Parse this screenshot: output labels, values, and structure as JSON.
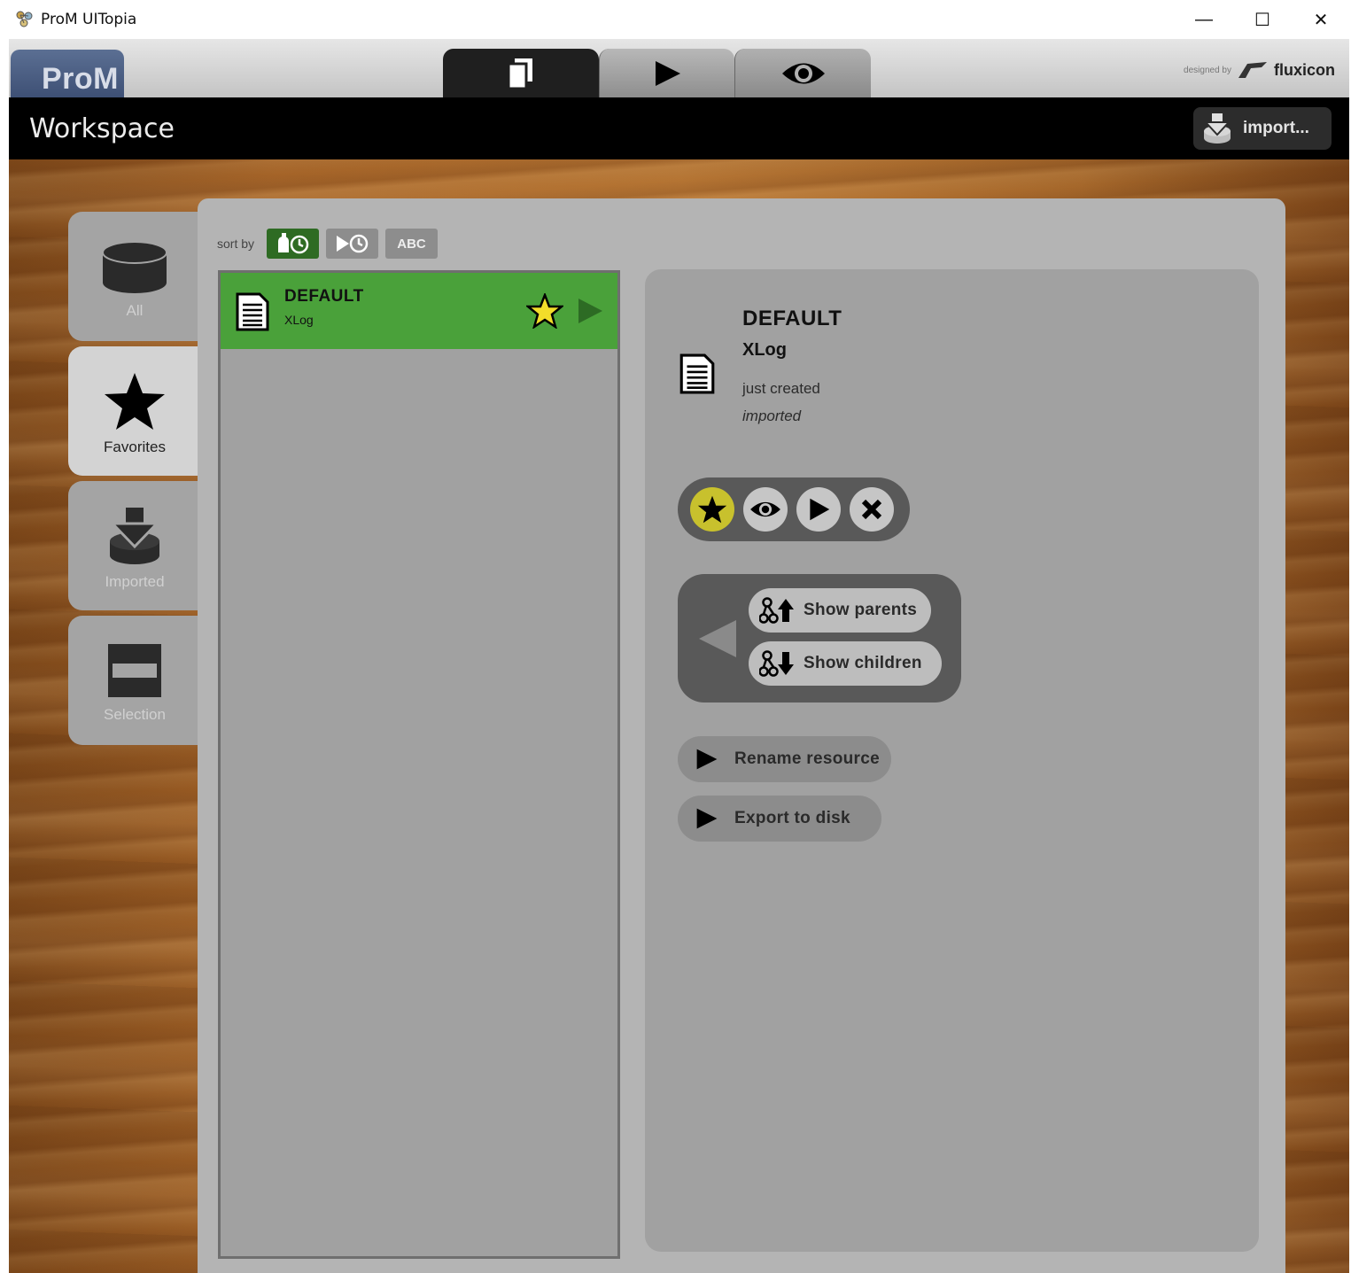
{
  "window": {
    "title": "ProM UITopia",
    "controls": {
      "minimize": "—",
      "maximize": "☐",
      "close": "✕"
    }
  },
  "topbar": {
    "logo": "ProM",
    "tabs": [
      {
        "icon": "workspace-documents-icon",
        "active": true
      },
      {
        "icon": "play-icon",
        "active": false
      },
      {
        "icon": "eye-icon",
        "active": false
      }
    ],
    "credit_prefix": "designed by",
    "credit_brand": "fluxicon"
  },
  "header": {
    "title": "Workspace",
    "import_label": "import..."
  },
  "sidebar": {
    "items": [
      {
        "label": "All",
        "icon": "database-icon",
        "active": false
      },
      {
        "label": "Favorites",
        "icon": "star-icon",
        "active": true
      },
      {
        "label": "Imported",
        "icon": "import-icon",
        "active": false
      },
      {
        "label": "Selection",
        "icon": "selection-icon",
        "active": false
      }
    ]
  },
  "sort": {
    "label": "sort by",
    "options": [
      {
        "icon": "creation-time-icon",
        "active": true
      },
      {
        "icon": "access-time-icon",
        "active": false
      },
      {
        "label": "ABC",
        "active": false
      }
    ]
  },
  "list": {
    "items": [
      {
        "name": "DEFAULT",
        "type": "XLog",
        "favorite": true,
        "selected": true
      }
    ]
  },
  "detail": {
    "name": "DEFAULT",
    "type": "XLog",
    "created": "just created",
    "origin": "imported",
    "actions": [
      "favorite",
      "view",
      "play",
      "remove"
    ],
    "show_parents": "Show parents",
    "show_children": "Show children",
    "rename": "Rename resource",
    "export": "Export to disk"
  },
  "colors": {
    "selected_item": "#4aa13a",
    "active_sort": "#2e6b23",
    "favorite_accent": "#c8c12d",
    "header_bg": "#000000"
  }
}
